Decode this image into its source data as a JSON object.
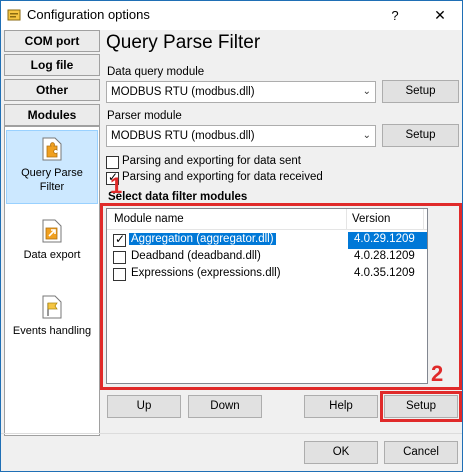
{
  "window": {
    "title": "Configuration options",
    "help_label": "?",
    "close_label": "✕"
  },
  "nav": {
    "top_buttons": [
      "COM port",
      "Log file",
      "Other",
      "Modules"
    ],
    "items": [
      {
        "label_line1": "Query Parse",
        "label_line2": "Filter",
        "icon": "puzzle-page-icon",
        "selected": true
      },
      {
        "label_line1": "Data export",
        "label_line2": "",
        "icon": "export-page-icon",
        "selected": false
      },
      {
        "label_line1": "Events handling",
        "label_line2": "",
        "icon": "flag-page-icon",
        "selected": false
      }
    ]
  },
  "page": {
    "title": "Query Parse Filter",
    "data_query_label": "Data query module",
    "data_query_value": "MODBUS RTU (modbus.dll)",
    "parser_label": "Parser module",
    "parser_value": "MODBUS RTU (modbus.dll)",
    "setup_label": "Setup",
    "check_sent_label": "Parsing and exporting for data sent",
    "check_sent_checked": false,
    "check_received_label": "Parsing and exporting for data received",
    "check_received_checked": true,
    "filter_section_title": "Select data filter modules",
    "columns": [
      "Module name",
      "Version"
    ],
    "modules": [
      {
        "name": "Aggregation (aggregator.dll)",
        "version": "4.0.29.1209",
        "checked": true,
        "selected": true
      },
      {
        "name": "Deadband (deadband.dll)",
        "version": "4.0.28.1209",
        "checked": false,
        "selected": false
      },
      {
        "name": "Expressions (expressions.dll)",
        "version": "4.0.35.1209",
        "checked": false,
        "selected": false
      }
    ],
    "buttons": {
      "up": "Up",
      "down": "Down",
      "help": "Help",
      "setup": "Setup"
    }
  },
  "annotations": {
    "badge1": "1",
    "badge2": "2",
    "color": "#e02a2a"
  },
  "footer": {
    "ok": "OK",
    "cancel": "Cancel"
  },
  "colors": {
    "selection": "#0078d7",
    "nav_selected": "#cce8ff"
  }
}
